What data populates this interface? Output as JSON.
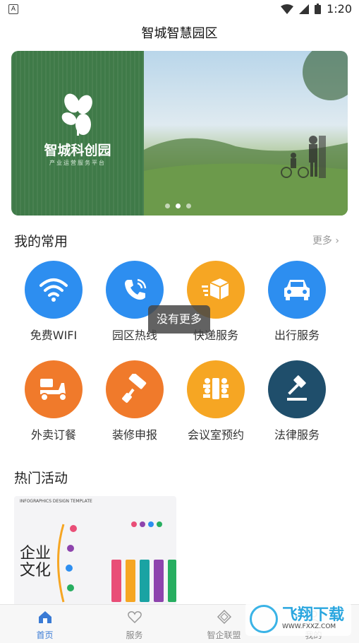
{
  "status": {
    "left_icon": "A",
    "time": "1:20"
  },
  "header": {
    "title": "智城智慧园区"
  },
  "banner": {
    "brand_name": "智城科创园",
    "brand_subtitle": "产业运营服务平台",
    "dots": 3,
    "active_dot": 1
  },
  "frequent": {
    "title": "我的常用",
    "more_label": "更多",
    "items": [
      {
        "label": "免费WIFI",
        "icon": "wifi-icon",
        "color": "#2d8ef0"
      },
      {
        "label": "园区热线",
        "icon": "phone-icon",
        "color": "#2d8ef0"
      },
      {
        "label": "快递服务",
        "icon": "package-icon",
        "color": "#f6a623"
      },
      {
        "label": "出行服务",
        "icon": "car-icon",
        "color": "#2d8ef0"
      },
      {
        "label": "外卖订餐",
        "icon": "scooter-icon",
        "color": "#f07a2b"
      },
      {
        "label": "装修申报",
        "icon": "paint-roller-icon",
        "color": "#f07a2b"
      },
      {
        "label": "会议室预约",
        "icon": "meeting-icon",
        "color": "#f6a623"
      },
      {
        "label": "法律服务",
        "icon": "gavel-icon",
        "color": "#1f4e6b"
      }
    ]
  },
  "toast": {
    "text": "没有更多"
  },
  "hot": {
    "title": "热门活动",
    "card": {
      "header_text": "INFOGRAPHICS DESIGN TEMPLATE",
      "big_text": "企业文化"
    }
  },
  "tabbar": {
    "tabs": [
      {
        "label": "首页",
        "icon": "home-icon",
        "active": true
      },
      {
        "label": "服务",
        "icon": "heart-icon",
        "active": false
      },
      {
        "label": "智企联盟",
        "icon": "diamond-icon",
        "active": false
      },
      {
        "label": "我的",
        "icon": "user-icon",
        "active": false
      }
    ]
  },
  "watermark": {
    "text": "飞翔下载",
    "url": "WWW.FXXZ.COM"
  }
}
